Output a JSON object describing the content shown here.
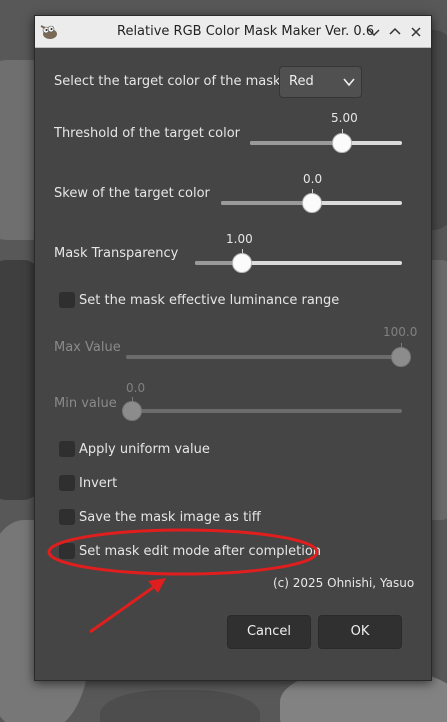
{
  "window": {
    "title": "Relative RGB Color Mask Maker Ver. 0.6",
    "icon": "gimp-wilber-icon"
  },
  "target_color": {
    "label": "Select the target color of the mask:",
    "selected": "Red"
  },
  "threshold": {
    "label": "Threshold of the target color",
    "value_text": "5.00",
    "fraction": 0.62
  },
  "skew": {
    "label": "Skew of the target color",
    "value_text": "0.0",
    "fraction": 0.5
  },
  "transparency": {
    "label": "Mask Transparency",
    "value_text": "1.00",
    "fraction": 0.2
  },
  "luminance_range": {
    "label": "Set the mask effective luminance range",
    "checked": false
  },
  "max_value": {
    "label": "Max Value",
    "value_text": "100.0",
    "fraction": 1.0,
    "enabled": false
  },
  "min_value": {
    "label": "Min value",
    "value_text": "0.0",
    "fraction": 0.0,
    "enabled": false
  },
  "options": [
    {
      "label": "Apply uniform value",
      "checked": false
    },
    {
      "label": "Invert",
      "checked": false
    },
    {
      "label": "Save the mask image as tiff",
      "checked": false
    },
    {
      "label": "Set mask edit mode after completion",
      "checked": false
    }
  ],
  "credit": "(c) 2025 Ohnishi, Yasuo",
  "buttons": {
    "cancel": "Cancel",
    "ok": "OK"
  },
  "colors": {
    "dialog_bg": "#454545",
    "titlebar_bg": "#ececec",
    "annotation_red": "#e01e1e"
  }
}
